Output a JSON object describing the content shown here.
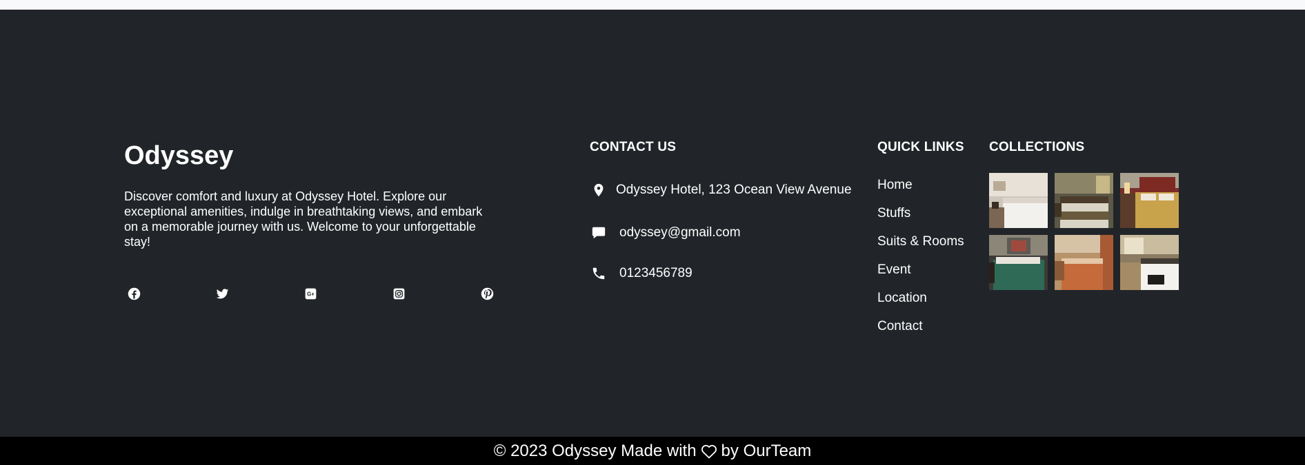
{
  "brand": {
    "name": "Odyssey",
    "description": "Discover comfort and luxury at Odyssey Hotel. Explore our exceptional amenities, indulge in breathtaking views, and embark on a memorable journey with us. Welcome to your unforgettable stay!",
    "social_icons": [
      "facebook-icon",
      "twitter-icon",
      "google-plus-icon",
      "instagram-icon",
      "pinterest-icon"
    ]
  },
  "contact": {
    "title": "CONTACT US",
    "address": "Odyssey Hotel, 123 Ocean View Avenue",
    "email": "odyssey@gmail.com",
    "phone": "0123456789",
    "icons": [
      "location-pin-icon",
      "message-icon",
      "phone-icon"
    ]
  },
  "quick_links": {
    "title": "QUICK LINKS",
    "items": [
      "Home",
      "Stuffs",
      "Suits & Rooms",
      "Event",
      "Location",
      "Contact"
    ]
  },
  "collections": {
    "title": "COLLECTIONS",
    "photos": [
      "hotel-room-photo",
      "hotel-room-photo",
      "hotel-room-photo",
      "hotel-room-photo",
      "hotel-room-photo",
      "hotel-room-photo"
    ]
  },
  "copyright": {
    "prefix": "© 2023 Odyssey Made with",
    "suffix": "by OurTeam",
    "icon": "heart-icon"
  },
  "colors": {
    "footer_bg": "#212529",
    "copyright_bg": "#000000",
    "text": "#ffffff",
    "top_strip": "#f8f9fa"
  }
}
